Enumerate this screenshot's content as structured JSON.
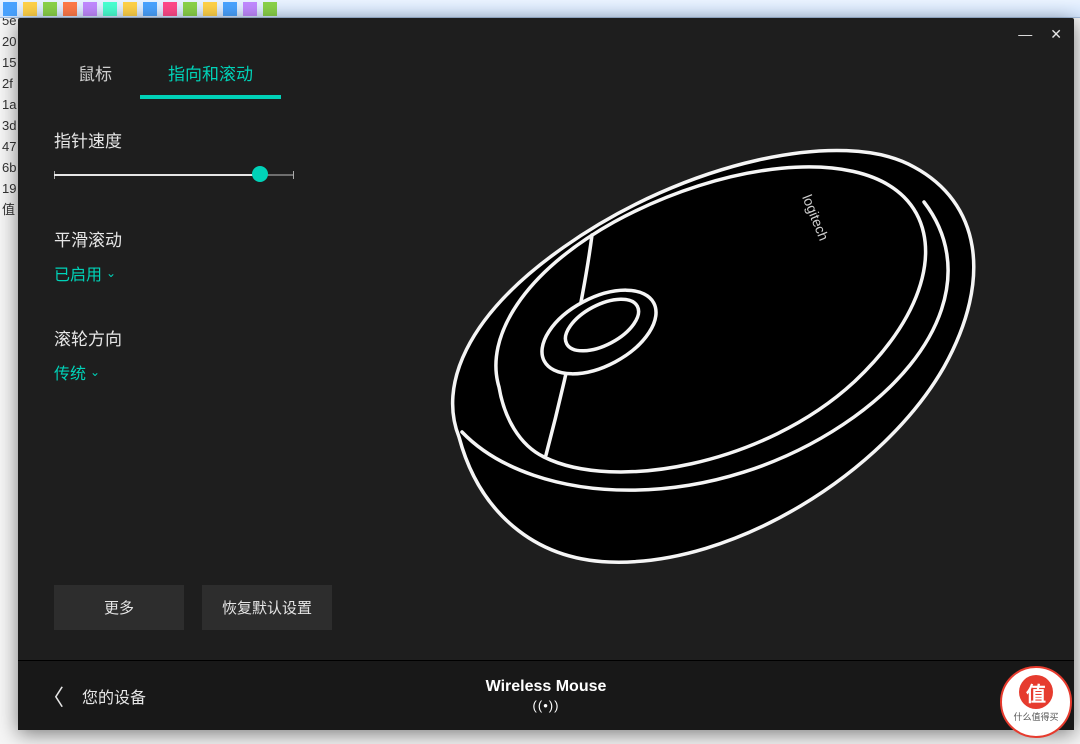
{
  "background_gutter": [
    "5e",
    "20",
    "15",
    "2f",
    "1a",
    "3d",
    "47",
    "6b",
    "19",
    "值"
  ],
  "window": {
    "minimize": "—",
    "close": "✕"
  },
  "tabs": [
    {
      "id": "mouse",
      "label": "鼠标",
      "active": false
    },
    {
      "id": "point",
      "label": "指向和滚动",
      "active": true
    }
  ],
  "settings": {
    "pointer_speed": {
      "label": "指针速度",
      "value_pct": 86
    },
    "smooth_scroll": {
      "label": "平滑滚动",
      "value": "已启用"
    },
    "wheel_dir": {
      "label": "滚轮方向",
      "value": "传统"
    }
  },
  "buttons": {
    "more": "更多",
    "restore": "恢复默认设置"
  },
  "mouse_brand": "logitech",
  "footer": {
    "back_label": "您的设备",
    "device_name": "Wireless Mouse",
    "signal_glyph": "((•))"
  },
  "badge": {
    "char": "值",
    "text": "什么值得买"
  },
  "colors": {
    "accent": "#00d2b8",
    "bg": "#1e1e1e"
  }
}
